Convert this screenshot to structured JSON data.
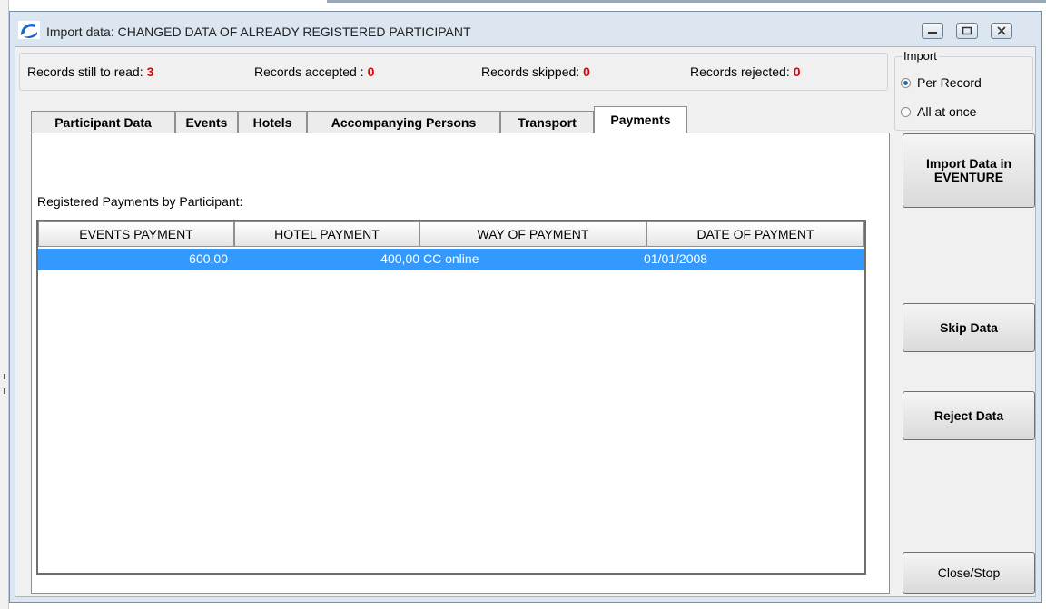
{
  "window": {
    "title": "Import data: CHANGED DATA OF ALREADY REGISTERED PARTICIPANT",
    "controls": [
      "minimize",
      "restore",
      "close"
    ]
  },
  "stats": {
    "still_to_read_label": "Records still to read:",
    "still_to_read_value": "3",
    "accepted_label": "Records accepted :",
    "accepted_value": "0",
    "skipped_label": "Records skipped:",
    "skipped_value": "0",
    "rejected_label": "Records rejected:",
    "rejected_value": "0"
  },
  "import_options": {
    "label": "Import",
    "per_record": "Per Record",
    "all_at_once": "All at once",
    "selected": "Per Record"
  },
  "tabs": [
    {
      "label": "Participant Data"
    },
    {
      "label": "Events"
    },
    {
      "label": "Hotels"
    },
    {
      "label": "Accompanying Persons"
    },
    {
      "label": "Transport"
    },
    {
      "label": "Payments"
    }
  ],
  "active_tab": "Payments",
  "payments": {
    "section_label": "Registered Payments by Participant:",
    "columns": [
      "EVENTS PAYMENT",
      "HOTEL PAYMENT",
      "WAY OF PAYMENT",
      "DATE OF PAYMENT"
    ],
    "rows": [
      {
        "events_payment": "600,00",
        "hotel_payment": "400,00",
        "way_of_payment": "CC online",
        "date_of_payment": "01/01/2008"
      }
    ]
  },
  "buttons": {
    "import": "Import Data in\nEVENTURE",
    "skip": "Skip Data",
    "reject": "Reject Data",
    "close": "Close/Stop"
  },
  "colors": {
    "accent_red": "#e00000",
    "selection_blue": "#3399ff",
    "window_frame": "#dce6f1"
  }
}
